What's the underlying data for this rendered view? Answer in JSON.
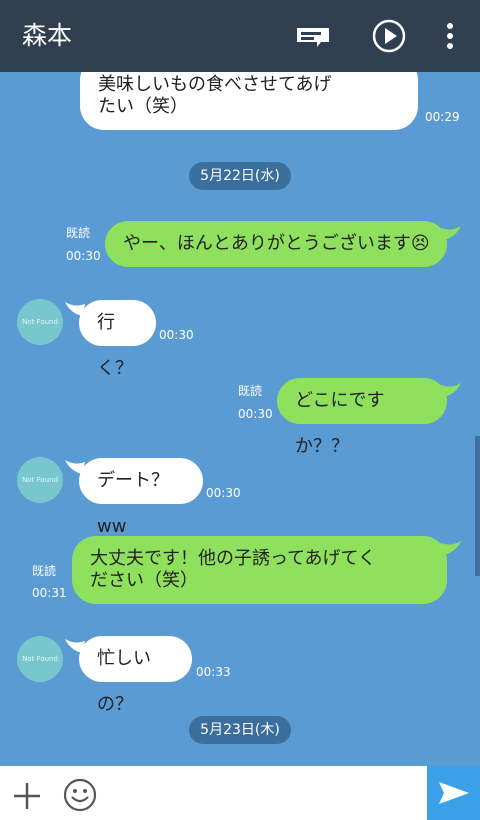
{
  "header": {
    "title": "森本",
    "icons": [
      "notes-icon",
      "play-circle-icon",
      "more-vert-icon"
    ]
  },
  "messages": [
    {
      "side": "in",
      "text": "美味しいもの食べさせてあげ\nたい（笑）",
      "time": "00:29"
    },
    {
      "date": "5月22日(水)"
    },
    {
      "side": "out",
      "text": "やー、ほんとありがとうございます😣",
      "time": "00:30",
      "read": "既読"
    },
    {
      "side": "in",
      "avatar": "Not Found",
      "text": "行く？",
      "time": "00:30"
    },
    {
      "side": "out",
      "text": "どこにですか？？",
      "time": "00:30",
      "read": "既読"
    },
    {
      "side": "in",
      "avatar": "Not Found",
      "text": "デート？ww",
      "time": "00:30"
    },
    {
      "side": "out",
      "text": "大丈夫です！他の子誘ってあげてく\nださい（笑）",
      "time": "00:31",
      "read": "既読"
    },
    {
      "side": "in",
      "avatar": "Not Found",
      "text": "忙しいの？",
      "time": "00:33"
    },
    {
      "date": "5月23日(木)"
    }
  ],
  "input": {
    "icons": [
      "plus-icon",
      "emoji-icon",
      "send-icon"
    ]
  },
  "colors": {
    "background": "#5b9bd4",
    "header": "#2f3f50",
    "bubble_out": "#8fe05c",
    "bubble_in": "#ffffff",
    "send": "#3aa1e8"
  }
}
